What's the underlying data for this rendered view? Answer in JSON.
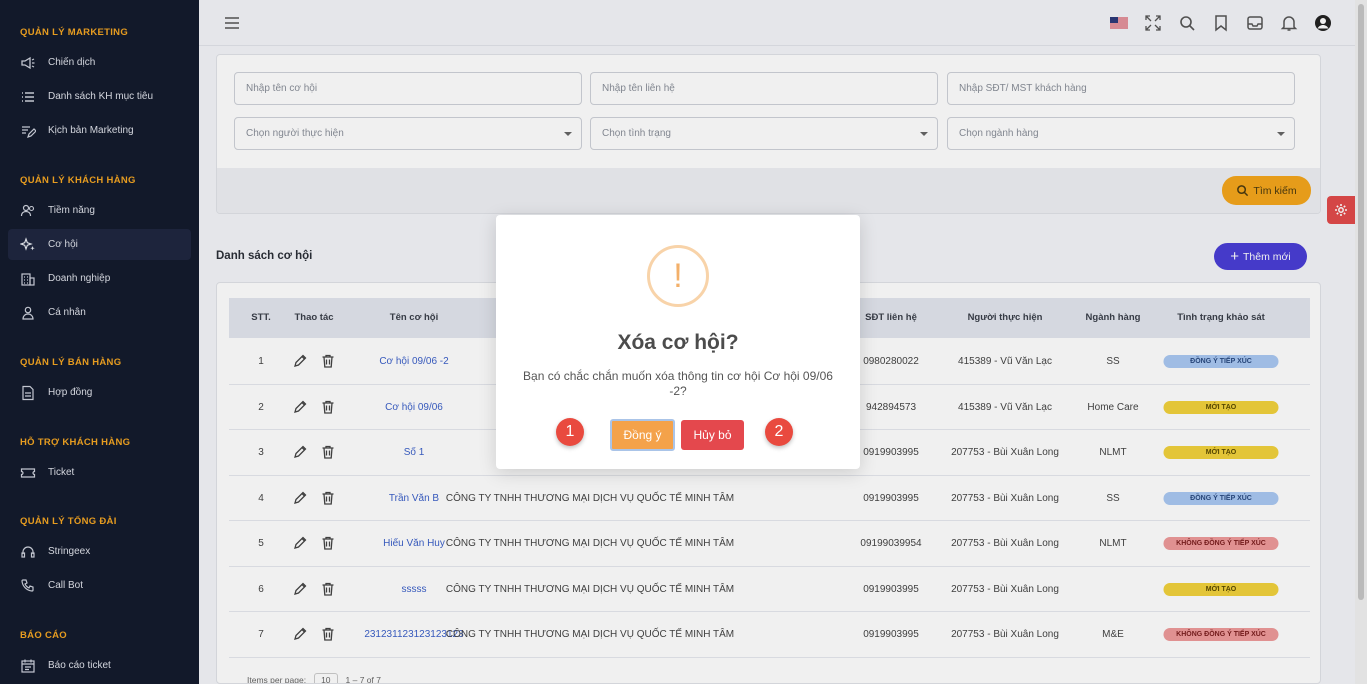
{
  "sidebar": {
    "sections": [
      {
        "title": "QUẢN LÝ MARKETING",
        "items": [
          "Chiến dịch",
          "Danh sách KH mục tiêu",
          "Kịch bản Marketing"
        ]
      },
      {
        "title": "QUẢN LÝ KHÁCH HÀNG",
        "items": [
          "Tiềm năng",
          "Cơ hội",
          "Doanh nghiệp",
          "Cá nhân"
        ]
      },
      {
        "title": "QUẢN LÝ BÁN HÀNG",
        "items": [
          "Hợp đồng"
        ]
      },
      {
        "title": "HỖ TRỢ KHÁCH HÀNG",
        "items": [
          "Ticket"
        ]
      },
      {
        "title": "QUẢN LÝ TỔNG ĐÀI",
        "items": [
          "Stringeex",
          "Call Bot"
        ]
      },
      {
        "title": "BÁO CÁO",
        "items": [
          "Báo cáo ticket"
        ]
      }
    ]
  },
  "filters": {
    "name_placeholder": "Nhập tên cơ hội",
    "contact_placeholder": "Nhập tên liên hệ",
    "phone_placeholder": "Nhập SĐT/ MST khách hàng",
    "assignee_placeholder": "Chọn người thực hiện",
    "status_placeholder": "Chọn tình trạng",
    "industry_placeholder": "Chọn ngành hàng",
    "search_label": "Tìm kiếm"
  },
  "list": {
    "title": "Danh sách cơ hội",
    "add_label": "Thêm mới"
  },
  "table": {
    "headers": [
      "STT.",
      "Thao tác",
      "Tên cơ hội",
      "SĐT liên hệ",
      "Người thực hiện",
      "Ngành hàng",
      "Tình trạng khảo sát"
    ],
    "rows": [
      {
        "stt": "1",
        "name": "Cơ hội 09/06 -2",
        "company": "",
        "phone": "0980280022",
        "assignee": "415389 - Vũ Văn Lạc",
        "industry": "SS",
        "status": "ĐỒNG Ý TIẾP XÚC",
        "status_color": "blue"
      },
      {
        "stt": "2",
        "name": "Cơ hội 09/06",
        "company": "",
        "phone": "942894573",
        "assignee": "415389 - Vũ Văn Lạc",
        "industry": "Home Care",
        "status": "MỚI TẠO",
        "status_color": "yellow"
      },
      {
        "stt": "3",
        "name": "Số 1",
        "company": "",
        "phone": "0919903995",
        "assignee": "207753 - Bùi Xuân Long",
        "industry": "NLMT",
        "status": "MỚI TẠO",
        "status_color": "yellow"
      },
      {
        "stt": "4",
        "name": "Trần Văn B",
        "company": "CÔNG TY TNHH THƯƠNG MẠI DỊCH VỤ QUỐC TẾ MINH TÂM",
        "phone": "0919903995",
        "assignee": "207753 - Bùi Xuân Long",
        "industry": "SS",
        "status": "ĐỒNG Ý TIẾP XÚC",
        "status_color": "blue"
      },
      {
        "stt": "5",
        "name": "Hiếu Văn Huy",
        "company": "CÔNG TY TNHH THƯƠNG MẠI DỊCH VỤ QUỐC TẾ MINH TÂM",
        "phone": "09199039954",
        "assignee": "207753 - Bùi Xuân Long",
        "industry": "NLMT",
        "status": "KHÔNG ĐỒNG Ý TIẾP XÚC",
        "status_color": "red"
      },
      {
        "stt": "6",
        "name": "sssss",
        "company": "CÔNG TY TNHH THƯƠNG MẠI DỊCH VỤ QUỐC TẾ MINH TÂM",
        "phone": "0919903995",
        "assignee": "207753 - Bùi Xuân Long",
        "industry": "",
        "status": "MỚI TẠO",
        "status_color": "yellow"
      },
      {
        "stt": "7",
        "name": "231231123123123123",
        "company": "CÔNG TY TNHH THƯƠNG MẠI DỊCH VỤ QUỐC TẾ MINH TÂM",
        "phone": "0919903995",
        "assignee": "207753 - Bùi Xuân Long",
        "industry": "M&E",
        "status": "KHÔNG ĐỒNG Ý TIẾP XÚC",
        "status_color": "red"
      }
    ]
  },
  "pager": {
    "label": "Items per page:",
    "size": "10",
    "range": "1 – 7 of 7"
  },
  "modal": {
    "icon": "!",
    "title": "Xóa cơ hội?",
    "message": "Bạn có chắc chắn muốn xóa thông tin cơ hội Cơ hội 09/06 -2?",
    "confirm_label": "Đồng ý",
    "cancel_label": "Hủy bỏ",
    "marker_1": "1",
    "marker_2": "2"
  },
  "colors": {
    "sidebar_bg": "#141b2d",
    "section_title": "#f5a623",
    "accent_orange": "#f5a61c",
    "accent_purple": "#4a3ed6",
    "danger": "#e4484d"
  }
}
